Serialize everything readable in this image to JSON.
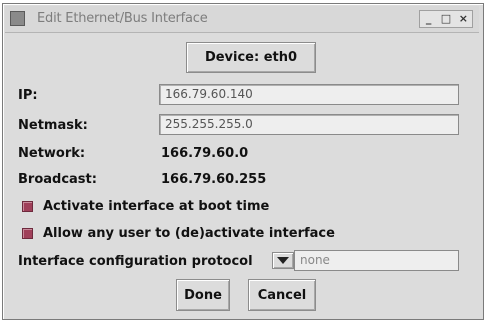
{
  "window": {
    "title": "Edit Ethernet/Bus Interface",
    "minimize": "_",
    "maximize": "□",
    "close": "×"
  },
  "device_button": "Device: eth0",
  "fields": {
    "ip": {
      "label": "IP:",
      "value": "166.79.60.140"
    },
    "netmask": {
      "label": "Netmask:",
      "value": "255.255.255.0"
    },
    "network": {
      "label": "Network:",
      "value": "166.79.60.0"
    },
    "broadcast": {
      "label": "Broadcast:",
      "value": "166.79.60.255"
    }
  },
  "options": {
    "activate_boot": {
      "label": "Activate interface at boot time",
      "checked": true
    },
    "allow_user": {
      "label": "Allow any user to (de)activate interface",
      "checked": true
    }
  },
  "protocol": {
    "label": "Interface configuration protocol",
    "value": "none"
  },
  "buttons": {
    "done": "Done",
    "cancel": "Cancel"
  },
  "colors": {
    "checkbox": "#a0405a",
    "window_bg": "#dcdcdc"
  }
}
